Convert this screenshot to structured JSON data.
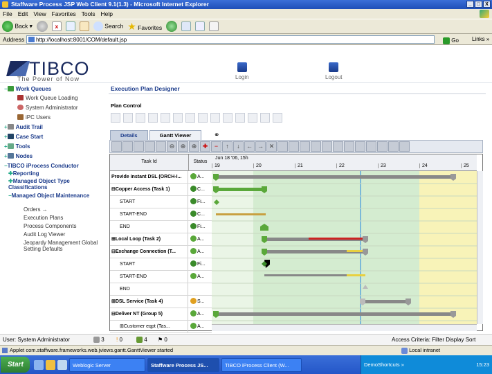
{
  "window": {
    "title": "Staffware Process JSP Web Client 9.1(1.3) - Microsoft Internet Explorer",
    "controls": [
      "_",
      "□",
      "X"
    ]
  },
  "menu": [
    "File",
    "Edit",
    "View",
    "Favorites",
    "Tools",
    "Help"
  ],
  "ie_toolbar": {
    "back": "Back",
    "search": "Search",
    "favorites": "Favorites"
  },
  "address": {
    "label": "Address",
    "url": "http://localhost:8001/COM/default.jsp",
    "go": "Go",
    "links": "Links »"
  },
  "header": {
    "logo": "TIBCO",
    "tagline": "The Power of Now",
    "login": "Login",
    "logout": "Logout"
  },
  "sidebar": {
    "work_queues": "Work Queues",
    "work_queue_loading": "Work Queue Loading",
    "system_administrator": "System Administrator",
    "ipc_users": "iPC Users",
    "audit_trail": "Audit Trail",
    "case_start": "Case Start",
    "tools": "Tools",
    "nodes": "Nodes",
    "conductor": "TIBCO iProcess Conductor",
    "reporting": "Reporting",
    "managed_object_type": "Managed Object Type Classifications",
    "managed_object_maint": "Managed Object Maintenance",
    "orders": "Orders →",
    "execution_plans": "Execution Plans",
    "process_components": "Process Components",
    "audit_log_viewer": "Audit Log Viewer",
    "jeopardy": "Jeopardy Management Global Setting Defaults"
  },
  "main": {
    "title": "Execution Plan Designer",
    "plan_control": "Plan Control",
    "tabs": [
      "Details",
      "Gantt Viewer"
    ]
  },
  "gantt": {
    "col_task": "Task Id",
    "col_status": "Status",
    "date_header": "Jun 18 '06, 15h",
    "days": [
      "19",
      "20",
      "21",
      "22",
      "23",
      "24",
      "25"
    ],
    "rows": [
      {
        "task": "Provide instant DSL (ORCH-I...",
        "status": "A..."
      },
      {
        "task": "⊟Copper Access (Task 1)",
        "status": "C..."
      },
      {
        "task": "START",
        "status": "Fi..."
      },
      {
        "task": "START-END",
        "status": "C..."
      },
      {
        "task": "END",
        "status": "Fi..."
      },
      {
        "task": "⊞Local Loop (Task 2)",
        "status": "A..."
      },
      {
        "task": "⊟Exchange Connection (T...",
        "status": "A..."
      },
      {
        "task": "START",
        "status": "Fi..."
      },
      {
        "task": "START-END",
        "status": "A..."
      },
      {
        "task": "END",
        "status": ""
      },
      {
        "task": "⊞DSL Service (Task 4)",
        "status": "S..."
      },
      {
        "task": "⊟Deliver NT (Group 5)",
        "status": "A..."
      },
      {
        "task": "⊞Customer eqpt (Tas...",
        "status": "A..."
      }
    ]
  },
  "status_bar": {
    "user": "User: System Administrator",
    "counts": [
      "3",
      "0",
      "4",
      "0"
    ],
    "criteria": "Access Criteria: Filter Display Sort"
  },
  "ie_status": {
    "text": "Applet com.staffware.frameworks.web.jviews.gantt.GanttViewer started",
    "zone": "Local intranet"
  },
  "taskbar": {
    "start": "Start",
    "items": [
      "Weblogic Server",
      "Staffware Process JS...",
      "TIBCO iProcess Client (W..."
    ],
    "tray": "DemoShortcuts »",
    "clock": "15:23"
  }
}
